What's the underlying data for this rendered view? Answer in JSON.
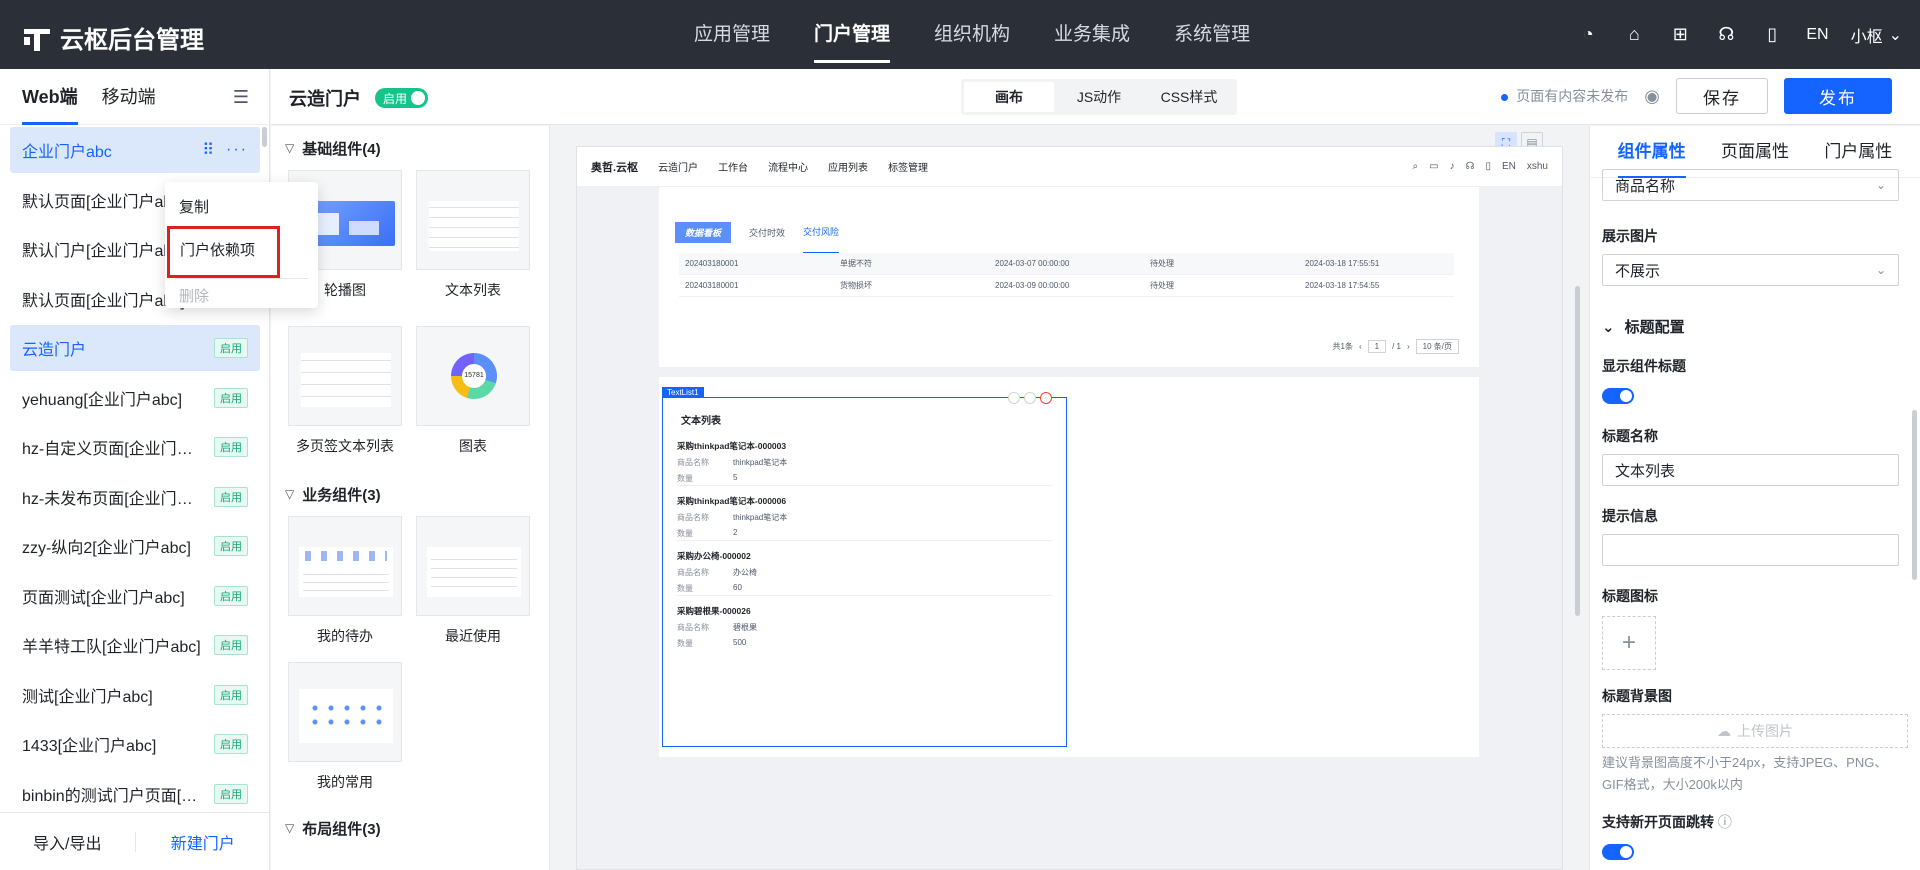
{
  "app": {
    "title": "云枢后台管理",
    "nav": [
      "应用管理",
      "门户管理",
      "组织机构",
      "业务集成",
      "系统管理"
    ],
    "active_nav": 1,
    "lang": "EN",
    "user": "小枢"
  },
  "sidebar": {
    "tabs": [
      "Web端",
      "移动端"
    ],
    "items": [
      {
        "label": "企业门户abc",
        "badge": "",
        "selected": true
      },
      {
        "label": "默认页面[企业门户abc]",
        "badge": ""
      },
      {
        "label": "默认门户[企业门户abc]",
        "badge": ""
      },
      {
        "label": "默认页面[企业门户abc]",
        "badge": ""
      },
      {
        "label": "云造门户",
        "badge": "启用",
        "selected": true
      },
      {
        "label": "yehuang[企业门户abc]",
        "badge": "启用"
      },
      {
        "label": "hz-自定义页面[企业门户abc]",
        "badge": "启用"
      },
      {
        "label": "hz-未发布页面[企业门户abc]",
        "badge": "启用"
      },
      {
        "label": "zzy-纵向2[企业门户abc]",
        "badge": "启用"
      },
      {
        "label": "页面测试[企业门户abc]",
        "badge": "启用"
      },
      {
        "label": "羊羊特工队[企业门户abc]",
        "badge": "启用"
      },
      {
        "label": "测试[企业门户abc]",
        "badge": "启用"
      },
      {
        "label": "1433[企业门户abc]",
        "badge": "启用"
      },
      {
        "label": "binbin的测试门户页面[企业门户abc]",
        "badge": "启用"
      }
    ],
    "footer": {
      "import_export": "导入/导出",
      "new_portal": "新建门户"
    }
  },
  "context_menu": {
    "copy": "复制",
    "dependencies": "门户依赖项",
    "delete": "删除"
  },
  "editor": {
    "portal_name": "云造门户",
    "status": "启用",
    "modes": [
      "画布",
      "JS动作",
      "CSS样式"
    ],
    "unpublished_note": "页面有内容未发布",
    "save": "保存",
    "publish": "发布"
  },
  "components": {
    "groups": [
      {
        "title": "基础组件(4)",
        "items": [
          "轮播图",
          "文本列表",
          "多页签文本列表",
          "图表"
        ]
      },
      {
        "title": "业务组件(3)",
        "items": [
          "我的待办",
          "最近使用",
          "我的常用"
        ]
      },
      {
        "title": "布局组件(3)",
        "items": []
      }
    ],
    "chart_center": "15781"
  },
  "preview": {
    "brand": "奥哲.云枢",
    "menu": [
      "云造门户",
      "工作台",
      "流程中心",
      "应用列表",
      "标签管理"
    ],
    "header_right": [
      "EN",
      "xshu"
    ],
    "tabs": {
      "badge": "数据看板",
      "items": [
        "交付时效",
        "交付风险"
      ]
    },
    "rows": [
      [
        "202403180001",
        "单据不符",
        "2024-03-07 00:00:00",
        "待处理",
        "2024-03-18 17:55:51"
      ],
      [
        "202403180001",
        "货物损坏",
        "2024-03-09 00:00:00",
        "待处理",
        "2024-03-18 17:54:55"
      ]
    ],
    "pager": {
      "total": "共1条",
      "page": "1",
      "pages": "/ 1",
      "size": "10 条/页"
    },
    "selected_tag": "TextList1",
    "textlist": {
      "title": "文本列表",
      "label_name": "商品名称",
      "label_qty": "数量",
      "items": [
        {
          "title": "采购thinkpad笔记本-000003",
          "name": "thinkpad笔记本",
          "qty": "5"
        },
        {
          "title": "采购thinkpad笔记本-000006",
          "name": "thinkpad笔记本",
          "qty": "2"
        },
        {
          "title": "采购办公椅-000002",
          "name": "办公椅",
          "qty": "60"
        },
        {
          "title": "采购碧根果-000026",
          "name": "碧根果",
          "qty": "500"
        }
      ]
    }
  },
  "props": {
    "tabs": [
      "组件属性",
      "页面属性",
      "门户属性"
    ],
    "top_select": "商品名称",
    "show_image_label": "展示图片",
    "show_image_value": "不展示",
    "section_title": "标题配置",
    "show_title_label": "显示组件标题",
    "title_name_label": "标题名称",
    "title_name_value": "文本列表",
    "hint_label": "提示信息",
    "title_icon_label": "标题图标",
    "bg_label": "标题背景图",
    "upload_label": "上传图片",
    "bg_hint": "建议背景图高度不小于24px，支持JPEG、PNG、GIF格式，大小200k以内",
    "new_page_label": "支持新开页面跳转"
  }
}
